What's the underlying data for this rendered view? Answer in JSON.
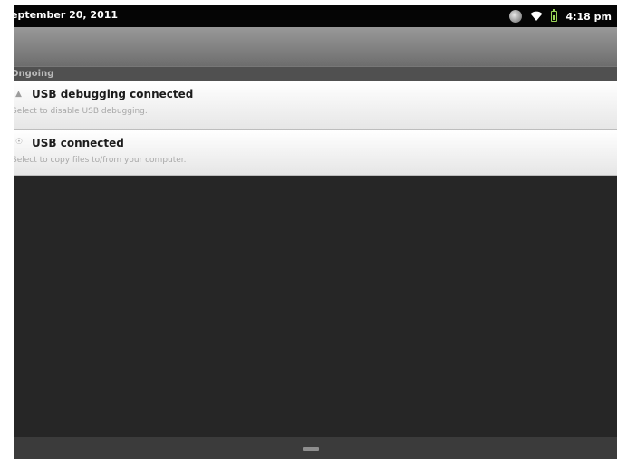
{
  "status_bar": {
    "date": "eptember 20, 2011",
    "time": "4:18 pm",
    "icons": [
      "globe-icon",
      "wifi-icon",
      "battery-icon"
    ],
    "battery_color": "#9cd657"
  },
  "notifications": {
    "section_label": "Ongoing",
    "items": [
      {
        "icon": "android-debug-icon",
        "title": "USB debugging connected",
        "subtitle": "Select to disable USB debugging."
      },
      {
        "icon": "usb-icon",
        "title": "USB connected",
        "subtitle": "Select to copy files to/from your computer."
      }
    ]
  },
  "bottom_bar": {
    "handle_icon": "drag-handle-icon"
  }
}
